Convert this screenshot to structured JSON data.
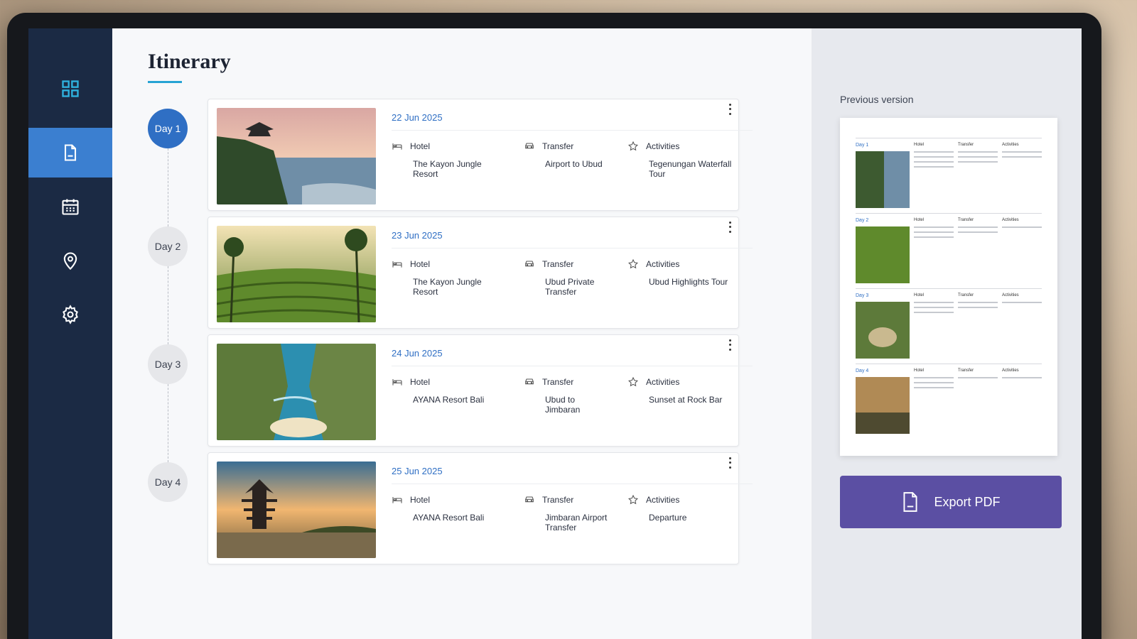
{
  "page": {
    "title": "Itinerary"
  },
  "sidebar": {
    "items": [
      {
        "icon": "grid-icon"
      },
      {
        "icon": "document-icon",
        "active": true
      },
      {
        "icon": "calendar-icon"
      },
      {
        "icon": "location-pin-icon"
      },
      {
        "icon": "settings-gear-icon"
      }
    ]
  },
  "days": [
    {
      "label": "Day 1",
      "date": "22 Jun 2025",
      "hotel_label": "Hotel",
      "hotel": "The Kayon Jungle Resort",
      "transfer_label": "Transfer",
      "transfer": "Airport to Ubud",
      "activities_label": "Activities",
      "activities": "Tegenungan Waterfall Tour",
      "active": true
    },
    {
      "label": "Day 2",
      "date": "23 Jun 2025",
      "hotel_label": "Hotel",
      "hotel": "The Kayon Jungle Resort",
      "transfer_label": "Transfer",
      "transfer": "Ubud Private Transfer",
      "activities_label": "Activities",
      "activities": "Ubud Highlights Tour"
    },
    {
      "label": "Day 3",
      "date": "24 Jun 2025",
      "hotel_label": "Hotel",
      "hotel": "AYANA Resort Bali",
      "transfer_label": "Transfer",
      "transfer": "Ubud to Jimbaran",
      "activities_label": "Activities",
      "activities": "Sunset at Rock Bar"
    },
    {
      "label": "Day 4",
      "date": "25 Jun 2025",
      "hotel_label": "Hotel",
      "hotel": "AYANA Resort Bali",
      "transfer_label": "Transfer",
      "transfer": "Jimbaran Airport Transfer",
      "activities_label": "Activities",
      "activities": "Departure"
    }
  ],
  "preview": {
    "label": "Previous version",
    "columns": [
      "Hotel",
      "Transfer",
      "Activities"
    ],
    "days": [
      "Day 1",
      "Day 2",
      "Day 3",
      "Day 4"
    ]
  },
  "export": {
    "label": "Export PDF"
  },
  "colors": {
    "sidebar": "#1b2a44",
    "accent": "#2f6fc4",
    "export": "#5b4fa3",
    "underline": "#27a3d4"
  }
}
